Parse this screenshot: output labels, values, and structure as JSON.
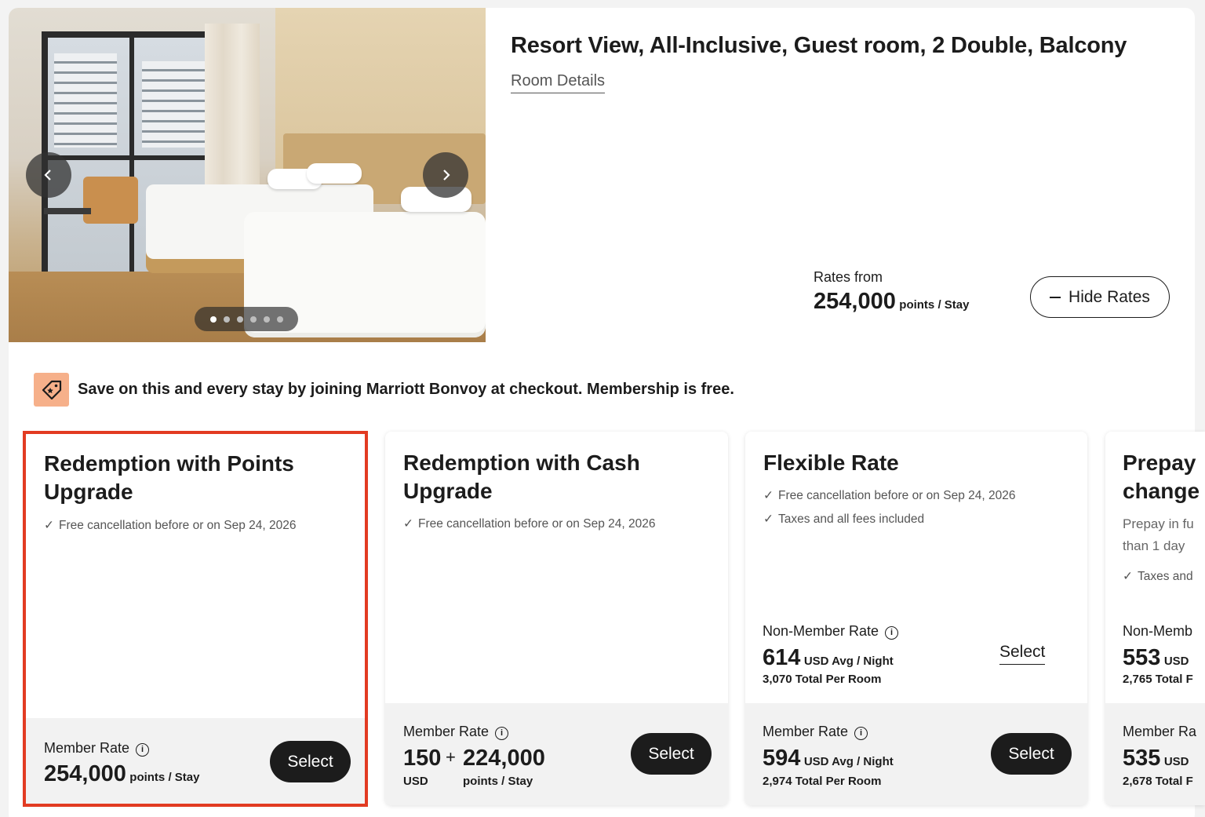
{
  "room": {
    "title": "Resort View, All-Inclusive, Guest room, 2 Double, Balcony",
    "details_link": "Room Details",
    "rates_from_label": "Rates from",
    "rates_from_value": "254,000",
    "rates_from_unit": "points / Stay",
    "hide_rates_label": "Hide Rates",
    "photo": {
      "image_count": 6,
      "active_index": 0
    }
  },
  "promo": {
    "text": "Save on this and every stay by joining Marriott Bonvoy at checkout. Membership is free.",
    "icon": "tag-icon"
  },
  "rates": [
    {
      "title_l1": "Redemption with Points",
      "title_l2": "Upgrade",
      "features": [
        "Free cancellation before or on Sep 24, 2026"
      ],
      "member_label": "Member Rate",
      "member_value": "254,000",
      "member_unit": "points / Stay",
      "select_label": "Select"
    },
    {
      "title_l1": "Redemption with Cash",
      "title_l2": "Upgrade",
      "features": [
        "Free cancellation before or on Sep 24, 2026"
      ],
      "member_label": "Member Rate",
      "cash_value": "150",
      "cash_unit": "USD",
      "plus": "+",
      "points_value": "224,000",
      "points_unit": "points / Stay",
      "select_label": "Select"
    },
    {
      "title_l1": "Flexible Rate",
      "features": [
        "Free cancellation before or on Sep 24, 2026",
        "Taxes and all fees included"
      ],
      "nonmember_label": "Non-Member Rate",
      "nonmember_value": "614",
      "nonmember_unit": "USD Avg / Night",
      "nonmember_total": "3,070 Total Per Room",
      "nonmember_select": "Select",
      "member_label": "Member Rate",
      "member_value": "594",
      "member_unit": "USD Avg / Night",
      "member_total": "2,974 Total Per Room",
      "select_label": "Select"
    },
    {
      "title_l1": "Prepay",
      "title_l2": "change",
      "desc_l1": "Prepay in fu",
      "desc_l2": "than 1 day",
      "features": [
        "Taxes and"
      ],
      "nonmember_label": "Non-Memb",
      "nonmember_value": "553",
      "nonmember_unit": "USD",
      "nonmember_total": "2,765 Total F",
      "member_label": "Member Ra",
      "member_value": "535",
      "member_unit": "USD",
      "member_total": "2,678 Total F"
    }
  ],
  "colors": {
    "highlight": "#e23b22",
    "promo_icon_bg": "#f6b08a",
    "button_dark": "#1c1c1c"
  }
}
